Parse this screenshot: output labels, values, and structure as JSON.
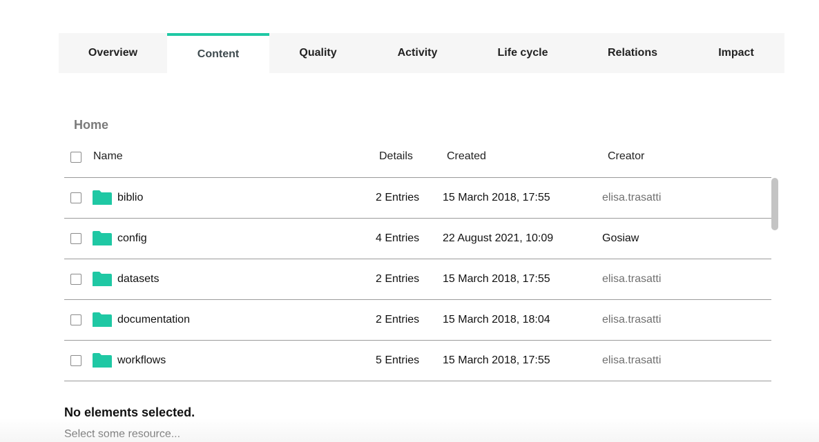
{
  "tabs": [
    {
      "label": "Overview"
    },
    {
      "label": "Content",
      "active": true
    },
    {
      "label": "Quality"
    },
    {
      "label": "Activity"
    },
    {
      "label": "Life cycle"
    },
    {
      "label": "Relations"
    },
    {
      "label": "Impact"
    }
  ],
  "accent_color": "#1fc8a4",
  "breadcrumb": "Home",
  "table": {
    "headers": {
      "name": "Name",
      "details": "Details",
      "created": "Created",
      "creator": "Creator"
    },
    "rows": [
      {
        "icon": "folder-icon",
        "name": "biblio",
        "details": "2 Entries",
        "created": "15 March 2018, 17:55",
        "creator": "elisa.trasatti"
      },
      {
        "icon": "folder-icon",
        "name": "config",
        "details": "4 Entries",
        "created": "22 August 2021, 10:09",
        "creator": "Gosiaw"
      },
      {
        "icon": "folder-icon",
        "name": "datasets",
        "details": "2 Entries",
        "created": "15 March 2018, 17:55",
        "creator": "elisa.trasatti"
      },
      {
        "icon": "folder-icon",
        "name": "documentation",
        "details": "2 Entries",
        "created": "15 March 2018, 18:04",
        "creator": "elisa.trasatti"
      },
      {
        "icon": "folder-icon",
        "name": "workflows",
        "details": "5 Entries",
        "created": "15 March 2018, 17:55",
        "creator": "elisa.trasatti"
      }
    ]
  },
  "selection": {
    "title": "No elements selected.",
    "hint": "Select some resource..."
  }
}
